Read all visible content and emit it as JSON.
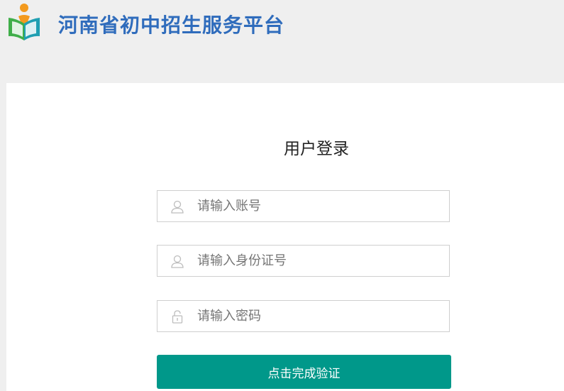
{
  "header": {
    "site_title": "河南省初中招生服务平台"
  },
  "login": {
    "title": "用户登录",
    "account": {
      "placeholder": "请输入账号",
      "value": ""
    },
    "id_number": {
      "placeholder": "请输入身份证号",
      "value": ""
    },
    "password": {
      "placeholder": "请输入密码",
      "value": ""
    },
    "verify_button_label": "点击完成验证"
  },
  "colors": {
    "brand_blue": "#2f6cbc",
    "button_green": "#00988a",
    "logo_orange": "#f39a1e",
    "logo_green": "#3fae49",
    "logo_teal": "#1f9fb2"
  },
  "icons": {
    "logo": "book-reader-logo",
    "account_field": "user-icon",
    "id_field": "user-icon",
    "password_field": "lock-icon"
  }
}
